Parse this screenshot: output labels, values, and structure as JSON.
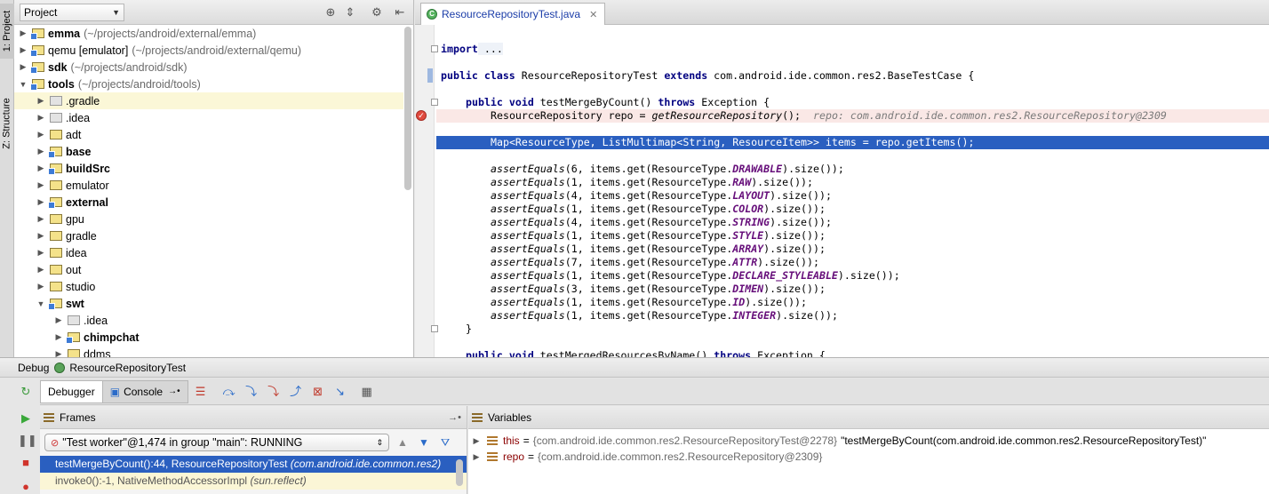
{
  "tool_windows": {
    "project_tab": "1: Project",
    "structure_tab": "Z: Structure"
  },
  "project_panel": {
    "selector_label": "Project",
    "tree": [
      {
        "name": "emma",
        "path": "(~/projects/android/external/emma)",
        "bold": true,
        "depth": 0,
        "expanded": false
      },
      {
        "name": "qemu [emulator]",
        "path": "(~/projects/android/external/qemu)",
        "bold": false,
        "depth": 0,
        "expanded": false
      },
      {
        "name": "sdk",
        "path": "(~/projects/android/sdk)",
        "bold": true,
        "depth": 0,
        "expanded": false
      },
      {
        "name": "tools",
        "path": "(~/projects/android/tools)",
        "bold": true,
        "depth": 0,
        "expanded": true
      },
      {
        "name": ".gradle",
        "path": "",
        "bold": false,
        "depth": 1,
        "expanded": false
      },
      {
        "name": ".idea",
        "path": "",
        "bold": false,
        "depth": 1,
        "expanded": false
      },
      {
        "name": "adt",
        "path": "",
        "bold": false,
        "depth": 1,
        "expanded": false
      },
      {
        "name": "base",
        "path": "",
        "bold": true,
        "depth": 1,
        "expanded": false
      },
      {
        "name": "buildSrc",
        "path": "",
        "bold": true,
        "depth": 1,
        "expanded": false
      },
      {
        "name": "emulator",
        "path": "",
        "bold": false,
        "depth": 1,
        "expanded": false
      },
      {
        "name": "external",
        "path": "",
        "bold": true,
        "depth": 1,
        "expanded": false
      },
      {
        "name": "gpu",
        "path": "",
        "bold": false,
        "depth": 1,
        "expanded": false
      },
      {
        "name": "gradle",
        "path": "",
        "bold": false,
        "depth": 1,
        "expanded": false
      },
      {
        "name": "idea",
        "path": "",
        "bold": false,
        "depth": 1,
        "expanded": false
      },
      {
        "name": "out",
        "path": "",
        "bold": false,
        "depth": 1,
        "expanded": false
      },
      {
        "name": "studio",
        "path": "",
        "bold": false,
        "depth": 1,
        "expanded": false
      },
      {
        "name": "swt",
        "path": "",
        "bold": true,
        "depth": 1,
        "expanded": true
      },
      {
        "name": ".idea",
        "path": "",
        "bold": false,
        "depth": 2,
        "expanded": false
      },
      {
        "name": "chimpchat",
        "path": "",
        "bold": true,
        "depth": 2,
        "expanded": false
      },
      {
        "name": "ddms",
        "path": "",
        "bold": false,
        "depth": 2,
        "expanded": false
      }
    ]
  },
  "editor": {
    "tab_label": "ResourceRepositoryTest.java",
    "code": {
      "import_kw": "import",
      "import_dots": " ...",
      "class_decl": [
        "public",
        " ",
        "class",
        " ResourceRepositoryTest ",
        "extends",
        " com.android.ide.common.res2.BaseTestCase {"
      ],
      "method_decl": [
        "public",
        " ",
        "void",
        " testMergeByCount() ",
        "throws",
        " Exception {"
      ],
      "repo_line": [
        "ResourceRepository repo = ",
        "getResourceRepository",
        "();"
      ],
      "repo_hint": "repo: com.android.ide.common.res2.ResourceRepository@2309",
      "current_line": "Map<ResourceType, ListMultimap<String, ResourceItem>> items = repo.getItems();",
      "asserts": [
        {
          "n": "6",
          "type": "DRAWABLE"
        },
        {
          "n": "1",
          "type": "RAW"
        },
        {
          "n": "4",
          "type": "LAYOUT"
        },
        {
          "n": "1",
          "type": "COLOR"
        },
        {
          "n": "4",
          "type": "STRING"
        },
        {
          "n": "1",
          "type": "STYLE"
        },
        {
          "n": "1",
          "type": "ARRAY"
        },
        {
          "n": "7",
          "type": "ATTR"
        },
        {
          "n": "1",
          "type": "DECLARE_STYLEABLE"
        },
        {
          "n": "3",
          "type": "DIMEN"
        },
        {
          "n": "1",
          "type": "ID"
        },
        {
          "n": "1",
          "type": "INTEGER"
        }
      ],
      "assert_fn": "assertEquals",
      "assert_mid": ", items.get(ResourceType.",
      "assert_end": ").size());",
      "closing_brace": "}",
      "next_method": [
        "public",
        " ",
        "void",
        " testMergedResourcesByName() ",
        "throws",
        " Exception {"
      ]
    }
  },
  "debug": {
    "title": "Debug",
    "config_name": "ResourceRepositoryTest",
    "tabs": {
      "debugger": "Debugger",
      "console": "Console"
    },
    "frames_header": "Frames",
    "variables_header": "Variables",
    "thread": "\"Test worker\"@1,474 in group \"main\": RUNNING",
    "frames": [
      {
        "method": "testMergeByCount():44, ResourceRepositoryTest",
        "pkg": "(com.android.ide.common.res2)"
      },
      {
        "method": "invoke0():-1, NativeMethodAccessorImpl",
        "pkg": "(sun.reflect)"
      }
    ],
    "variables": [
      {
        "name": "this",
        "ref": "{com.android.ide.common.res2.ResourceRepositoryTest@2278}",
        "str": "\"testMergeByCount(com.android.ide.common.res2.ResourceRepositoryTest)\""
      },
      {
        "name": "repo",
        "ref": "{com.android.ide.common.res2.ResourceRepository@2309}",
        "str": ""
      }
    ]
  },
  "colors": {
    "selection": "#2a5fc0",
    "breakpoint_line": "#fae8e6",
    "keyword": "#000080",
    "constant": "#660e7a"
  }
}
